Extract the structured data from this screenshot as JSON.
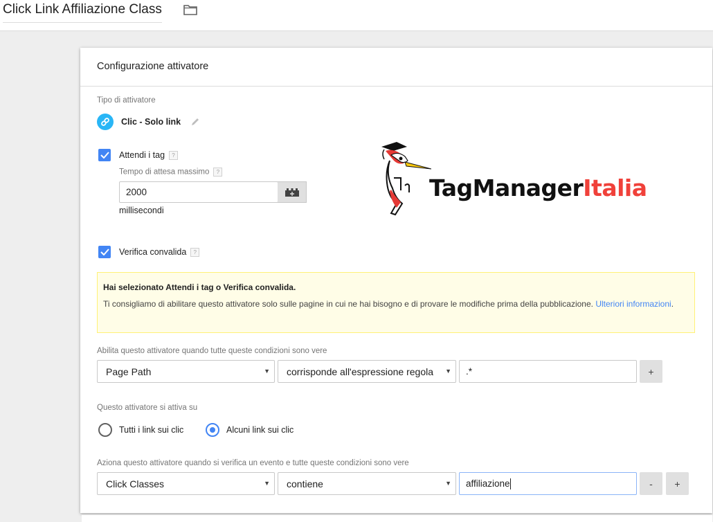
{
  "header": {
    "title": "Click Link Affiliazione Class",
    "folder_icon": "folder-icon"
  },
  "card": {
    "title": "Configurazione attivatore",
    "trigger_type_label": "Tipo di attivatore",
    "trigger_type": {
      "icon": "link-icon",
      "name": "Clic - Solo link",
      "edit_icon": "pencil-icon"
    },
    "wait_for_tags": {
      "checked": true,
      "label": "Attendi i tag",
      "help": "?",
      "max_wait_label": "Tempo di attesa massimo",
      "max_wait_help": "?",
      "max_wait_value": "2000",
      "variable_icon": "variable-add-icon",
      "unit": "millisecondi"
    },
    "check_validation": {
      "checked": true,
      "label": "Verifica convalida",
      "help": "?"
    },
    "logo": {
      "text_dark": "TagManager",
      "text_red": "Italia",
      "brand_red": "#f0413a"
    },
    "notice": {
      "heading": "Hai selezionato Attendi i tag o Verifica convalida.",
      "body": "Ti consigliamo di abilitare questo attivatore solo sulle pagine in cui ne hai bisogno e di provare le modifiche prima della pubblicazione. ",
      "link": "Ulteriori informazioni",
      "period": "."
    },
    "enable_conditions": {
      "label": "Abilita questo attivatore quando tutte queste condizioni sono vere",
      "variable": "Page Path",
      "operator": "corrisponde all'espressione regolare",
      "value": ".*",
      "add_label": "+"
    },
    "fires_on": {
      "label": "Questo attivatore si attiva su",
      "options": [
        {
          "label": "Tutti i link sui clic",
          "selected": false
        },
        {
          "label": "Alcuni link sui clic",
          "selected": true
        }
      ]
    },
    "fire_conditions": {
      "label": "Aziona questo attivatore quando si verifica un evento e tutte queste condizioni sono vere",
      "variable": "Click Classes",
      "operator": "contiene",
      "value": "affiliazione",
      "remove_label": "-",
      "add_label": "+"
    }
  },
  "colors": {
    "accent_blue": "#4285f4",
    "link_icon_bg": "#29b6f6",
    "notice_bg": "#fffde7",
    "notice_border": "#fff176"
  }
}
